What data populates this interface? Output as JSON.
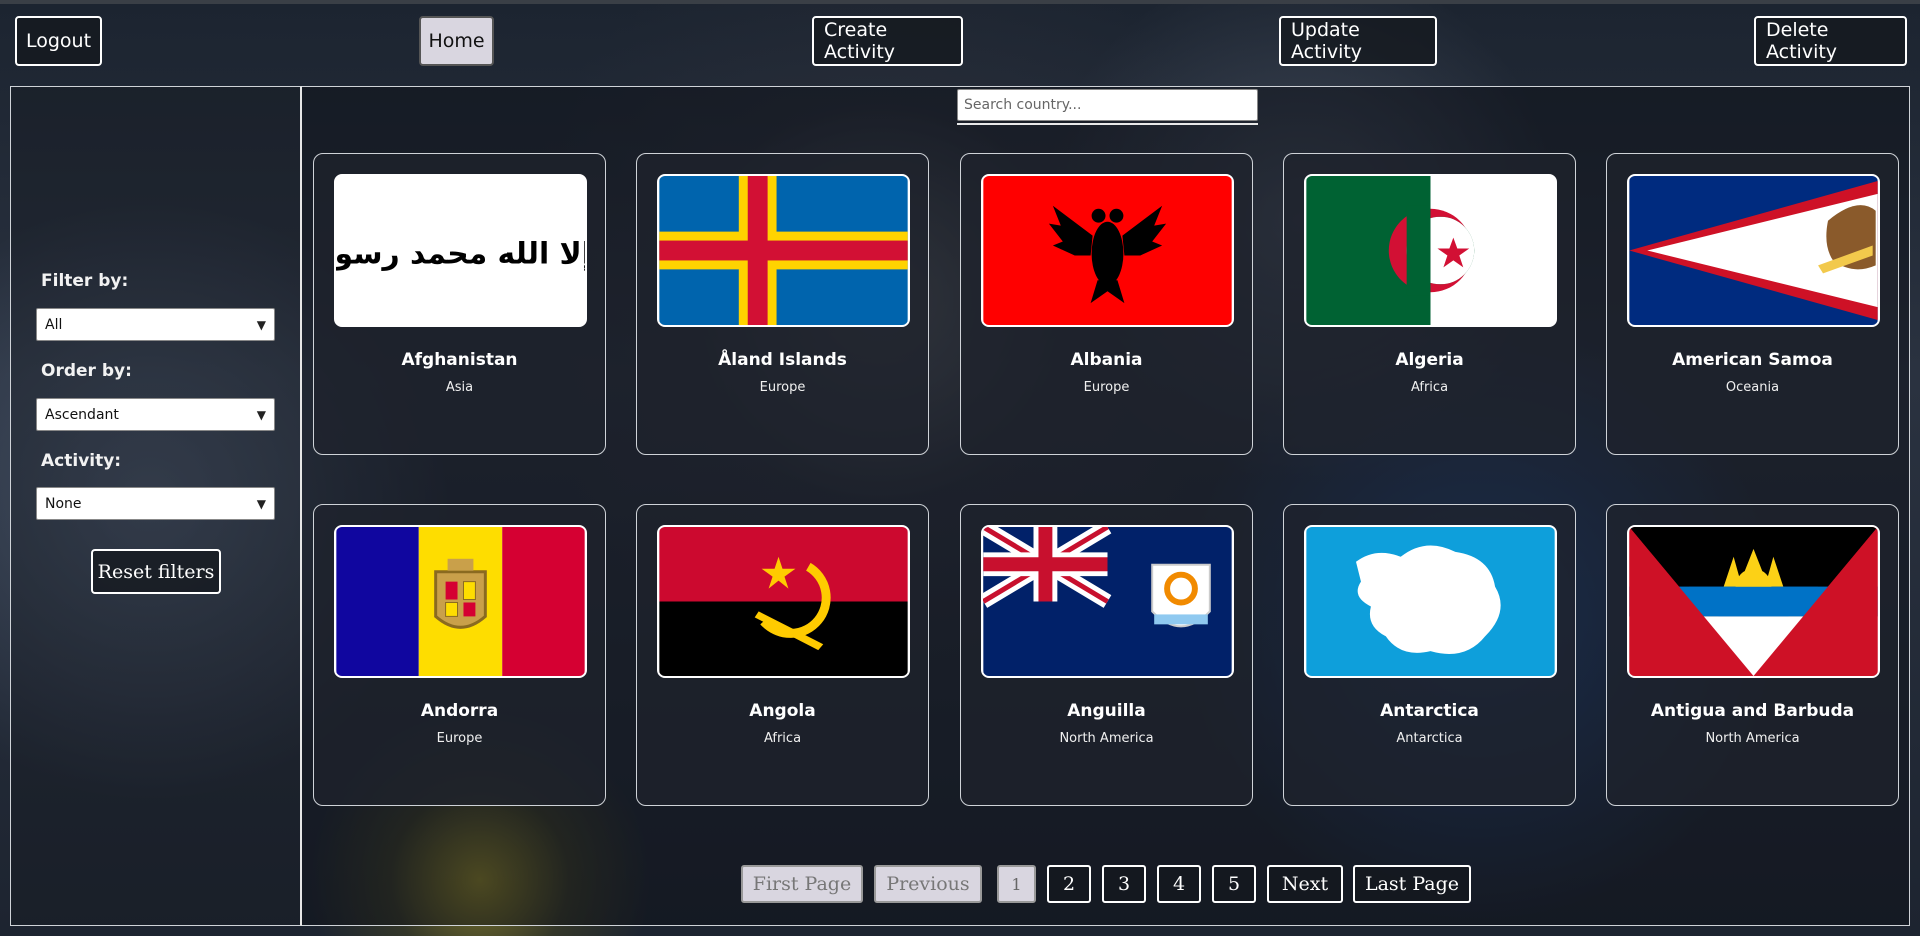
{
  "nav": {
    "logout": "Logout",
    "home": "Home",
    "create": "Create Activity",
    "update": "Update Activity",
    "delete": "Delete Activity"
  },
  "sidebar": {
    "filter_label": "Filter by:",
    "filter_value": "All",
    "order_label": "Order by:",
    "order_value": "Ascendant",
    "activity_label": "Activity:",
    "activity_value": "None",
    "reset": "Reset filters"
  },
  "search": {
    "placeholder": "Search country..."
  },
  "countries": [
    {
      "name": "Afghanistan",
      "continent": "Asia"
    },
    {
      "name": "Åland Islands",
      "continent": "Europe"
    },
    {
      "name": "Albania",
      "continent": "Europe"
    },
    {
      "name": "Algeria",
      "continent": "Africa"
    },
    {
      "name": "American Samoa",
      "continent": "Oceania"
    },
    {
      "name": "Andorra",
      "continent": "Europe"
    },
    {
      "name": "Angola",
      "continent": "Africa"
    },
    {
      "name": "Anguilla",
      "continent": "North America"
    },
    {
      "name": "Antarctica",
      "continent": "Antarctica"
    },
    {
      "name": "Antigua and Barbuda",
      "continent": "North America"
    }
  ],
  "flag_script_text": "لا إله إلا الله محمد رسول الله",
  "pagination": {
    "first": "First Page",
    "previous": "Previous",
    "pages": [
      "1",
      "2",
      "3",
      "4",
      "5"
    ],
    "current_page": "1",
    "next": "Next",
    "last": "Last Page"
  },
  "colors": {
    "border": "#ffffff",
    "card_bg": "#1e222c",
    "disabled_btn": "#d9d6e0"
  }
}
